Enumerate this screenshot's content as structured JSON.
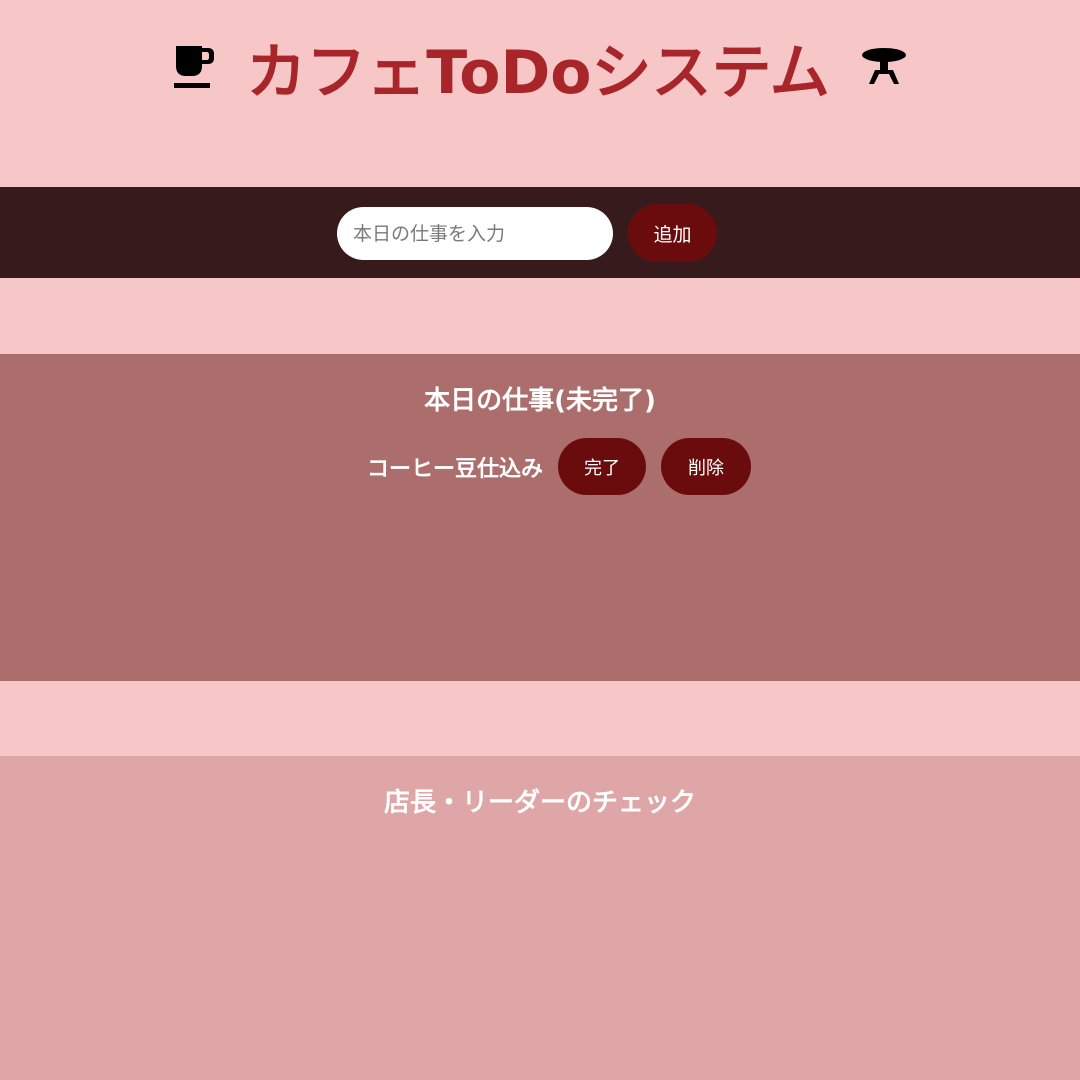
{
  "header": {
    "title": "カフェToDoシステム",
    "left_icon": "coffee-cup-icon",
    "right_icon": "cafe-table-icon"
  },
  "input_bar": {
    "placeholder": "本日の仕事を入力",
    "add_label": "追加"
  },
  "incomplete": {
    "title": "本日の仕事(未完了)",
    "items": [
      {
        "text": "コーヒー豆仕込み",
        "complete_label": "完了",
        "delete_label": "削除"
      }
    ]
  },
  "check": {
    "title": "店長・リーダーのチェック"
  },
  "colors": {
    "background": "#f7c6c7",
    "title": "#a8262a",
    "input_bar": "#371a1b",
    "button": "#6a0c0d",
    "incomplete_section": "#ab6e6d",
    "check_section": "#dfa6a7"
  }
}
